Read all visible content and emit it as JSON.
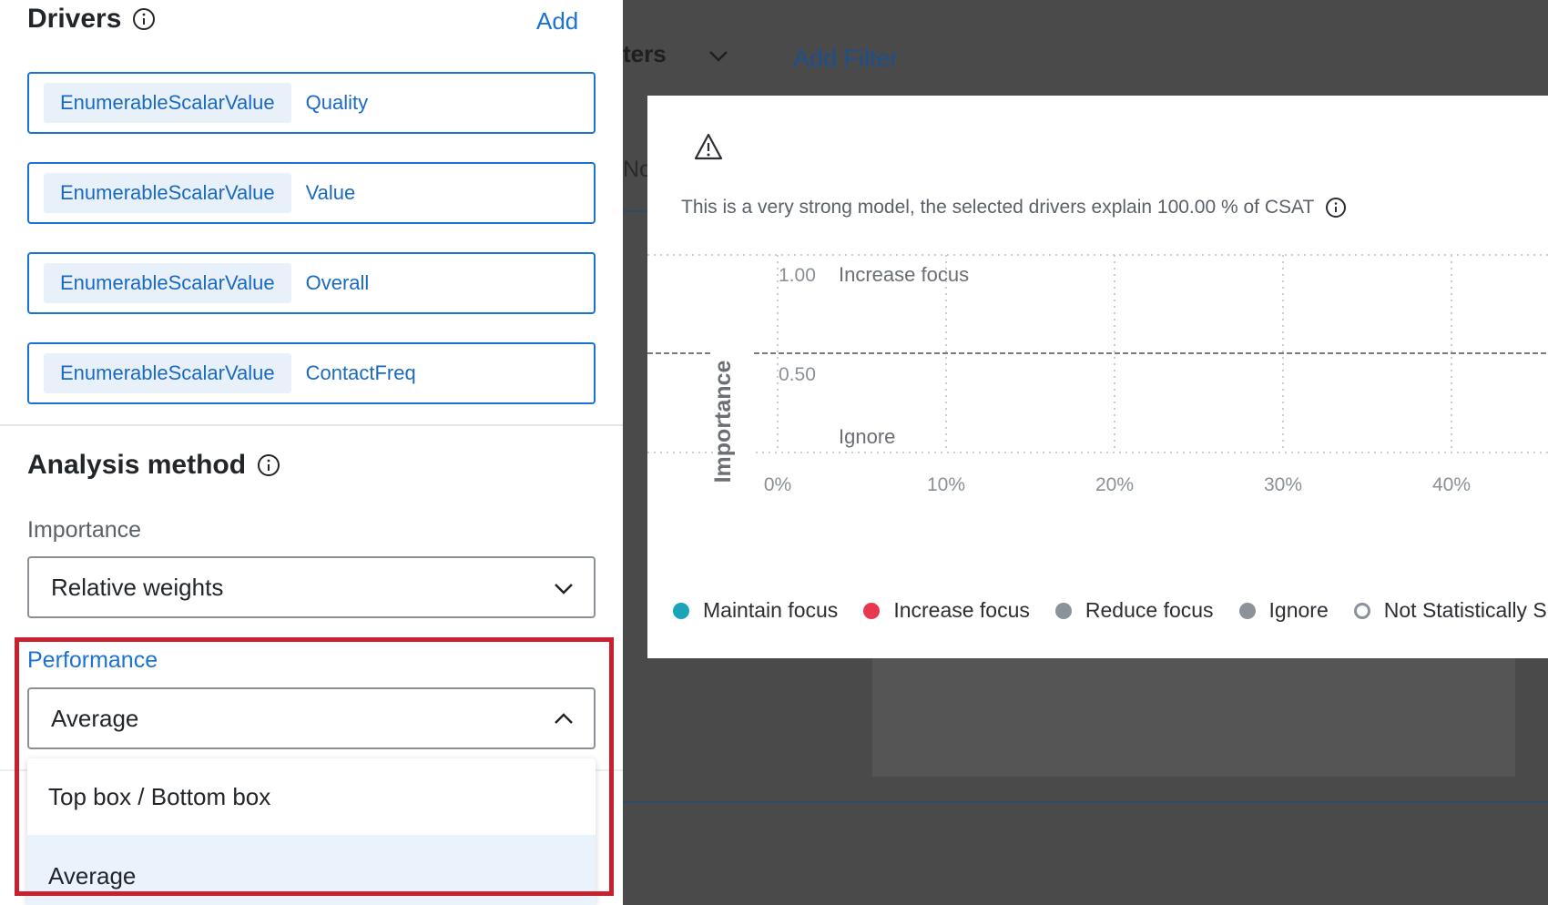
{
  "drivers": {
    "title": "Drivers",
    "add_label": "Add",
    "items": [
      {
        "tag": "EnumerableScalarValue",
        "name": "Quality"
      },
      {
        "tag": "EnumerableScalarValue",
        "name": "Value"
      },
      {
        "tag": "EnumerableScalarValue",
        "name": "Overall"
      },
      {
        "tag": "EnumerableScalarValue",
        "name": "ContactFreq"
      }
    ]
  },
  "analysis": {
    "title": "Analysis method",
    "importance_label": "Importance",
    "importance_value": "Relative weights",
    "performance_label": "Performance",
    "performance_value": "Average",
    "performance_options": [
      "Top box / Bottom box",
      "Average"
    ],
    "selected_option": "Average"
  },
  "background": {
    "filters_fragment": "ters",
    "add_filter": "Add Filter",
    "partial_text": "No"
  },
  "modal": {
    "message": "This is a very strong model, the selected drivers explain 100.00 % of CSAT",
    "warning_icon": "warning-triangle-icon",
    "info_icon": "info-circle-icon"
  },
  "chart_data": {
    "type": "scatter",
    "title": "",
    "ylabel": "Importance",
    "xlabel": "",
    "y_ticks": [
      "1.00",
      "0.50"
    ],
    "x_ticks": [
      "0%",
      "10%",
      "20%",
      "30%",
      "40%"
    ],
    "quadrant_labels": [
      "Increase focus",
      "Ignore"
    ],
    "grid": true,
    "points": []
  },
  "legend": [
    {
      "label": "Maintain focus",
      "color": "#1ba3b8",
      "filled": true
    },
    {
      "label": "Increase focus",
      "color": "#e8384f",
      "filled": true
    },
    {
      "label": "Reduce focus",
      "color": "#8b9299",
      "filled": true
    },
    {
      "label": "Ignore",
      "color": "#8b9299",
      "filled": true
    },
    {
      "label": "Not Statistically Sig",
      "color": "#8b9299",
      "filled": false
    }
  ]
}
